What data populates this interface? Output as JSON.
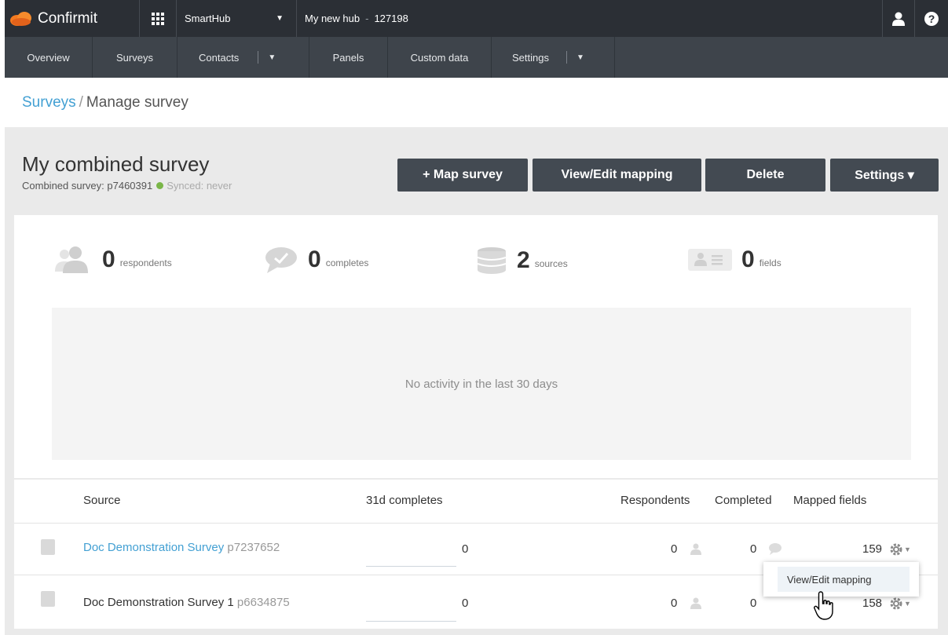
{
  "topbar": {
    "brand": "Confirmit",
    "hub_select": "SmartHub",
    "hub_name": "My new hub",
    "hub_id": "127198"
  },
  "nav": {
    "items": [
      "Overview",
      "Surveys",
      "Contacts",
      "Panels",
      "Custom data",
      "Settings"
    ]
  },
  "breadcrumb": {
    "link": "Surveys",
    "separator": "/",
    "current": "Manage survey"
  },
  "survey": {
    "title": "My combined survey",
    "subtitle": "Combined survey: p7460391",
    "sync_status": "Synced: never"
  },
  "actions": {
    "map_survey": "+ Map survey",
    "view_edit_mapping": "View/Edit mapping",
    "delete": "Delete",
    "settings": "Settings ▾"
  },
  "stats": [
    {
      "value": "0",
      "label": "respondents",
      "icon": "respondents-icon"
    },
    {
      "value": "0",
      "label": "completes",
      "icon": "completes-icon"
    },
    {
      "value": "2",
      "label": "sources",
      "icon": "sources-icon"
    },
    {
      "value": "0",
      "label": "fields",
      "icon": "fields-icon"
    }
  ],
  "activity": {
    "empty_text": "No activity in the last 30 days"
  },
  "table": {
    "headers": {
      "source": "Source",
      "completes_31d": "31d completes",
      "respondents": "Respondents",
      "completed": "Completed",
      "mapped_fields": "Mapped fields"
    },
    "rows": [
      {
        "name": "Doc Demonstration Survey",
        "id": "p7237652",
        "completes_31d": "0",
        "respondents": "0",
        "completed": "0",
        "mapped_fields": "159",
        "is_link": true
      },
      {
        "name": "Doc Demonstration Survey 1",
        "id": "p6634875",
        "completes_31d": "0",
        "respondents": "0",
        "completed": "0",
        "mapped_fields": "158",
        "is_link": false
      }
    ]
  },
  "context_menu": {
    "item": "View/Edit mapping"
  },
  "colors": {
    "topbar_bg": "#2b2f35",
    "navbar_bg": "#3e444b",
    "button_bg": "#434a52",
    "link": "#43a0d3",
    "sync_ok": "#7ab648"
  }
}
